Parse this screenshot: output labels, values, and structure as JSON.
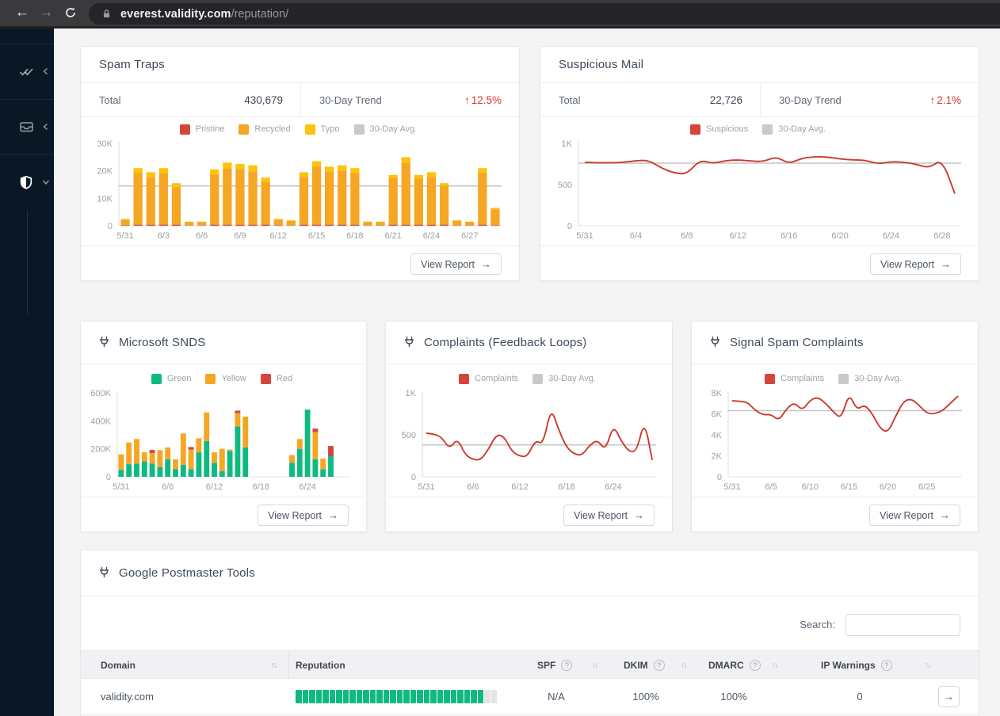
{
  "browser": {
    "url_host": "everest.validity.com",
    "url_path": "/reputation/"
  },
  "ui": {
    "view_report": "View Report",
    "arrow_right": "→",
    "trend_up": "↑",
    "help_glyph": "?",
    "sort_up": "↑",
    "sort_down": "↓"
  },
  "cards": {
    "spam_traps": {
      "title": "Spam Traps",
      "total_label": "Total",
      "total_value": "430,679",
      "trend_label": "30-Day Trend",
      "trend_value": "12.5%"
    },
    "suspicious_mail": {
      "title": "Suspicious Mail",
      "total_label": "Total",
      "total_value": "22,726",
      "trend_label": "30-Day Trend",
      "trend_value": "2.1%"
    },
    "microsoft_snds": {
      "title": "Microsoft SNDS"
    },
    "complaints_fbl": {
      "title": "Complaints (Feedback Loops)"
    },
    "signal_spam": {
      "title": "Signal Spam Complaints"
    },
    "google_postmaster": {
      "title": "Google Postmaster Tools"
    }
  },
  "chart_data": [
    {
      "id": "spam_traps",
      "type": "bar",
      "title": "Spam Traps",
      "ylim": [
        0,
        30000
      ],
      "y_ticks": [
        0,
        10000,
        20000,
        30000
      ],
      "y_tick_labels": [
        "0",
        "10K",
        "20K",
        "30K"
      ],
      "n_points": 30,
      "avg": 14500,
      "legend_position": "top-center",
      "grid": false,
      "x_labels": [
        "5/31",
        "6/3",
        "6/6",
        "6/9",
        "6/12",
        "6/15",
        "6/18",
        "6/21",
        "6/24",
        "6/27"
      ],
      "x_tick_positions": [
        0,
        3,
        6,
        9,
        12,
        15,
        18,
        21,
        24,
        27
      ],
      "legend": [
        {
          "label": "Pristine",
          "color": "#D6453A"
        },
        {
          "label": "Recycled",
          "color": "#F5A623"
        },
        {
          "label": "Typo",
          "color": "#FDC30A"
        },
        {
          "label": "30-Day Avg.",
          "color": "#C9C9C9"
        }
      ],
      "series": [
        {
          "name": "Pristine",
          "color": "#D6453A",
          "values": [
            150,
            400,
            400,
            400,
            400,
            100,
            100,
            400,
            400,
            400,
            400,
            400,
            150,
            100,
            400,
            400,
            400,
            400,
            400,
            100,
            100,
            400,
            400,
            400,
            400,
            400,
            100,
            100,
            400,
            200
          ]
        },
        {
          "name": "Recycled",
          "color": "#F5A623",
          "values": [
            2050,
            18800,
            17300,
            18800,
            13600,
            1200,
            1200,
            18300,
            20600,
            20200,
            19400,
            15600,
            2050,
            1650,
            17400,
            21100,
            19200,
            19700,
            18800,
            1200,
            1200,
            16900,
            22600,
            16800,
            17300,
            14100,
            1650,
            1200,
            19000,
            5800
          ]
        },
        {
          "name": "Typo",
          "color": "#FDC30A",
          "values": [
            300,
            1800,
            1800,
            1800,
            1500,
            200,
            200,
            1800,
            2000,
            1900,
            2200,
            1500,
            300,
            250,
            1700,
            2000,
            1900,
            1900,
            1800,
            200,
            200,
            1200,
            2000,
            1300,
            1800,
            1000,
            250,
            200,
            1600,
            500
          ]
        }
      ]
    },
    {
      "id": "suspicious_mail",
      "type": "line",
      "title": "Suspicious Mail",
      "ylim": [
        0,
        1000
      ],
      "y_ticks": [
        0,
        500,
        1000
      ],
      "y_tick_labels": [
        "0",
        "500",
        "1K"
      ],
      "n_points": 30,
      "avg": 760,
      "legend_position": "top-center",
      "grid": false,
      "x_labels": [
        "5/31",
        "6/4",
        "6/8",
        "6/12",
        "6/16",
        "6/20",
        "6/24",
        "6/28"
      ],
      "x_tick_positions": [
        0,
        4,
        8,
        12,
        16,
        20,
        24,
        28
      ],
      "legend": [
        {
          "label": "Suspicious",
          "color": "#D6453A"
        },
        {
          "label": "30-Day Avg.",
          "color": "#C9C9C9"
        }
      ],
      "series": [
        {
          "name": "Suspicious",
          "color": "#CC3A2E",
          "values": [
            770,
            765,
            765,
            768,
            790,
            795,
            700,
            640,
            625,
            800,
            755,
            790,
            800,
            785,
            778,
            840,
            752,
            820,
            838,
            835,
            810,
            800,
            795,
            750,
            778,
            772,
            745,
            700,
            810,
            390
          ]
        }
      ]
    },
    {
      "id": "microsoft_snds",
      "type": "bar",
      "title": "Microsoft SNDS",
      "ylim": [
        0,
        600000
      ],
      "y_ticks": [
        0,
        200000,
        400000,
        600000
      ],
      "y_tick_labels": [
        "0",
        "200K",
        "400K",
        "600K"
      ],
      "n_points": 30,
      "avg": null,
      "legend_position": "top-center",
      "grid": false,
      "x_labels": [
        "5/31",
        "6/6",
        "6/12",
        "6/18",
        "6/24"
      ],
      "x_tick_positions": [
        0,
        6,
        12,
        18,
        24
      ],
      "legend": [
        {
          "label": "Green",
          "color": "#10B981"
        },
        {
          "label": "Yellow",
          "color": "#F5A623"
        },
        {
          "label": "Red",
          "color": "#D6453A"
        }
      ],
      "series": [
        {
          "name": "Green",
          "color": "#10B981",
          "values": [
            50000,
            90000,
            95000,
            110000,
            95000,
            70000,
            125000,
            55000,
            85000,
            55000,
            175000,
            255000,
            100000,
            40000,
            185000,
            360000,
            210000,
            0,
            0,
            0,
            0,
            0,
            100000,
            200000,
            480000,
            125000,
            55000,
            150000,
            0,
            0
          ]
        },
        {
          "name": "Yellow",
          "color": "#F5A623",
          "values": [
            110000,
            155000,
            175000,
            65000,
            75000,
            120000,
            85000,
            70000,
            225000,
            140000,
            100000,
            205000,
            75000,
            160000,
            10000,
            95000,
            220000,
            0,
            0,
            0,
            0,
            0,
            55000,
            70000,
            0,
            195000,
            75000,
            0,
            0,
            0
          ]
        },
        {
          "name": "Red",
          "color": "#D6453A",
          "values": [
            0,
            0,
            0,
            0,
            22000,
            0,
            0,
            0,
            0,
            18000,
            0,
            0,
            0,
            0,
            0,
            18000,
            0,
            0,
            0,
            0,
            0,
            0,
            0,
            0,
            0,
            25000,
            0,
            70000,
            0,
            0
          ]
        }
      ]
    },
    {
      "id": "complaints_fbl",
      "type": "line",
      "title": "Complaints (Feedback Loops)",
      "ylim": [
        0,
        1000
      ],
      "y_ticks": [
        0,
        500,
        1000
      ],
      "y_tick_labels": [
        "0",
        "500",
        "1K"
      ],
      "n_points": 30,
      "avg": 380,
      "legend_position": "top-center",
      "grid": false,
      "x_labels": [
        "5/31",
        "6/6",
        "6/12",
        "6/18",
        "6/24"
      ],
      "x_tick_positions": [
        0,
        6,
        12,
        18,
        24
      ],
      "legend": [
        {
          "label": "Complaints",
          "color": "#D6453A"
        },
        {
          "label": "30-Day Avg.",
          "color": "#C9C9C9"
        }
      ],
      "series": [
        {
          "name": "Complaints",
          "color": "#CC3A2E",
          "values": [
            520,
            510,
            470,
            330,
            460,
            260,
            205,
            200,
            330,
            505,
            480,
            300,
            245,
            240,
            440,
            380,
            830,
            560,
            350,
            270,
            255,
            380,
            440,
            310,
            620,
            430,
            300,
            300,
            680,
            200
          ]
        }
      ]
    },
    {
      "id": "signal_spam",
      "type": "line",
      "title": "Signal Spam Complaints",
      "ylim": [
        0,
        8000
      ],
      "y_ticks": [
        0,
        2000,
        4000,
        6000,
        8000
      ],
      "y_tick_labels": [
        "0",
        "2K",
        "4K",
        "6K",
        "8K"
      ],
      "n_points": 30,
      "avg": 6300,
      "legend_position": "top-center",
      "grid": false,
      "x_labels": [
        "5/31",
        "6/5",
        "6/10",
        "6/15",
        "6/20",
        "6/25"
      ],
      "x_tick_positions": [
        0,
        5,
        10,
        15,
        20,
        25
      ],
      "legend": [
        {
          "label": "Complaints",
          "color": "#D6453A"
        },
        {
          "label": "30-Day Avg.",
          "color": "#C9C9C9"
        }
      ],
      "series": [
        {
          "name": "Complaints",
          "color": "#CC3A2E",
          "values": [
            7250,
            7200,
            7100,
            6300,
            5900,
            5950,
            5350,
            6500,
            7100,
            6300,
            7300,
            7600,
            7000,
            6200,
            5500,
            8000,
            6350,
            6900,
            6000,
            4600,
            4200,
            5800,
            7200,
            7450,
            6800,
            6050,
            6000,
            6300,
            7000,
            7700
          ]
        }
      ]
    }
  ],
  "table": {
    "search_label": "Search:",
    "search_value": "",
    "headers": [
      {
        "label": "Domain"
      },
      {
        "label": "Reputation"
      },
      {
        "label": "SPF"
      },
      {
        "label": "DKIM"
      },
      {
        "label": "DMARC"
      },
      {
        "label": "IP Warnings"
      }
    ],
    "rows": [
      {
        "domain": "validity.com",
        "reputation_filled": 28,
        "reputation_total": 30,
        "spf": "N/A",
        "dkim": "100%",
        "dmarc": "100%",
        "ip_warnings": "0"
      }
    ]
  },
  "colors": {
    "green": "#10B981",
    "orange": "#F5A623",
    "yellow": "#FDC30A",
    "red": "#D6453A",
    "avg_gray": "#C2C4C6",
    "trend_red": "#D93425",
    "segment_empty": "#E3E4E6"
  }
}
